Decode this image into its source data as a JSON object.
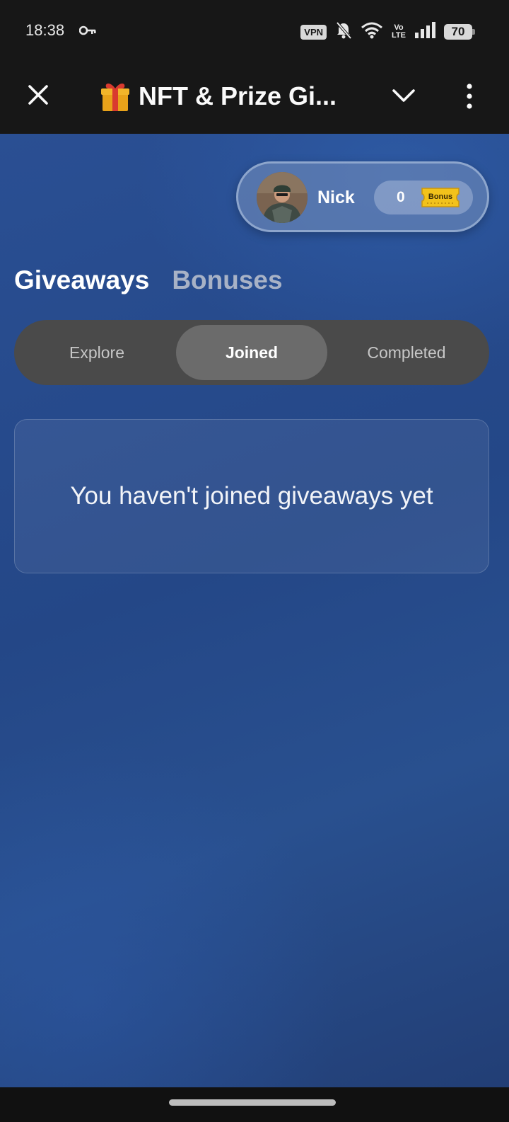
{
  "status_bar": {
    "time": "18:38",
    "vpn_label": "VPN",
    "volte_top": "Vo",
    "volte_bottom": "LTE",
    "battery": "70"
  },
  "app_bar": {
    "title": "NFT & Prize Gi..."
  },
  "profile": {
    "name": "Nick",
    "bonus_count": "0",
    "bonus_label": "Bonus"
  },
  "section_tabs": [
    {
      "label": "Giveaways",
      "active": true
    },
    {
      "label": "Bonuses",
      "active": false
    }
  ],
  "segments": [
    {
      "label": "Explore",
      "selected": false
    },
    {
      "label": "Joined",
      "selected": true
    },
    {
      "label": "Completed",
      "selected": false
    }
  ],
  "empty_state": {
    "message": "You haven't joined giveaways yet"
  },
  "colors": {
    "background": "#2a4f93",
    "segment_track": "#4a4a4a",
    "segment_selected": "#6b6b6b",
    "bonus_gold": "#f2c21b"
  }
}
